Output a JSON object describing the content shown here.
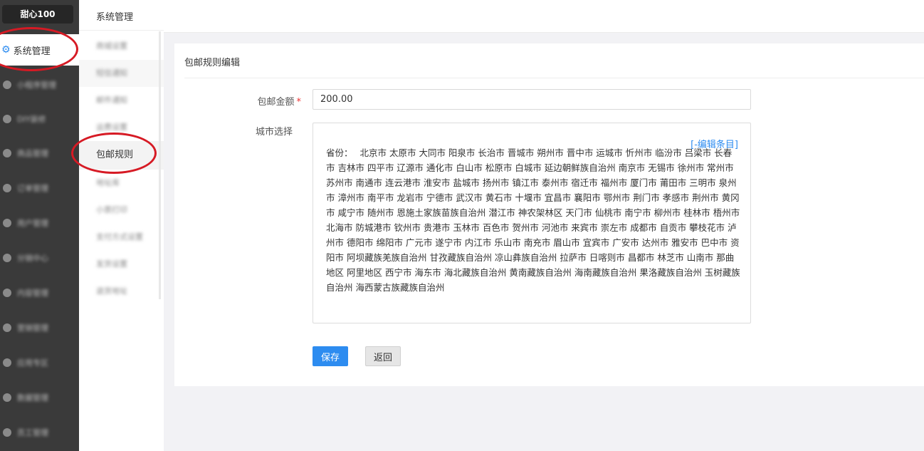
{
  "sidebar": {
    "brand": "甜心100",
    "active_item": "系统管理",
    "blurred_items": [
      {
        "label": "小程序管理",
        "icon": "link-icon"
      },
      {
        "label": "DIY装修",
        "icon": "diy-icon"
      },
      {
        "label": "商品管理",
        "icon": "goods-icon"
      },
      {
        "label": "订单管理",
        "icon": "order-icon"
      },
      {
        "label": "用户管理",
        "icon": "user-icon"
      },
      {
        "label": "分销中心",
        "icon": "share-icon"
      },
      {
        "label": "内容管理",
        "icon": "content-icon"
      },
      {
        "label": "营销管理",
        "icon": "marketing-icon"
      },
      {
        "label": "应用专区",
        "icon": "app-icon"
      },
      {
        "label": "数据管理",
        "icon": "data-icon"
      },
      {
        "label": "员工管理",
        "icon": "staff-icon"
      }
    ]
  },
  "submenu": {
    "title": "系统管理",
    "blurred_items_top": [
      "商城设置",
      "短信通知",
      "邮件通知",
      "运费设置"
    ],
    "active_item": "包邮规则",
    "blurred_items_bottom": [
      "地址库",
      "小票打印",
      "支付方式设置",
      "发货设置",
      "退货地址"
    ]
  },
  "form": {
    "title": "包邮规则编辑",
    "amount_label": "包邮金额",
    "required_mark": "*",
    "amount_value": "200.00",
    "city_label": "城市选择",
    "edit_link": "[-编辑条目]",
    "province_prefix": "省份：",
    "cities": "北京市 太原市 大同市 阳泉市 长治市 晋城市 朔州市 晋中市 运城市 忻州市 临汾市 吕梁市 长春市 吉林市 四平市 辽源市 通化市 白山市 松原市 白城市 延边朝鲜族自治州 南京市 无锡市 徐州市 常州市 苏州市 南通市 连云港市 淮安市 盐城市 扬州市 镇江市 泰州市 宿迁市 福州市 厦门市 莆田市 三明市 泉州市 漳州市 南平市 龙岩市 宁德市 武汉市 黄石市 十堰市 宜昌市 襄阳市 鄂州市 荆门市 孝感市 荆州市 黄冈市 咸宁市 随州市 恩施土家族苗族自治州 潜江市 神农架林区 天门市 仙桃市 南宁市 柳州市 桂林市 梧州市 北海市 防城港市 钦州市 贵港市 玉林市 百色市 贺州市 河池市 来宾市 崇左市 成都市 自贡市 攀枝花市 泸州市 德阳市 绵阳市 广元市 遂宁市 内江市 乐山市 南充市 眉山市 宜宾市 广安市 达州市 雅安市 巴中市 资阳市 阿坝藏族羌族自治州 甘孜藏族自治州 凉山彝族自治州 拉萨市 日喀则市 昌都市 林芝市 山南市 那曲地区 阿里地区 西宁市 海东市 海北藏族自治州 黄南藏族自治州 海南藏族自治州 果洛藏族自治州 玉树藏族自治州 海西蒙古族藏族自治州",
    "save_label": "保存",
    "back_label": "返回"
  },
  "colors": {
    "primary": "#2d8cf0",
    "sidebar_bg": "#3a3a3a",
    "annotation": "#d61a24"
  }
}
